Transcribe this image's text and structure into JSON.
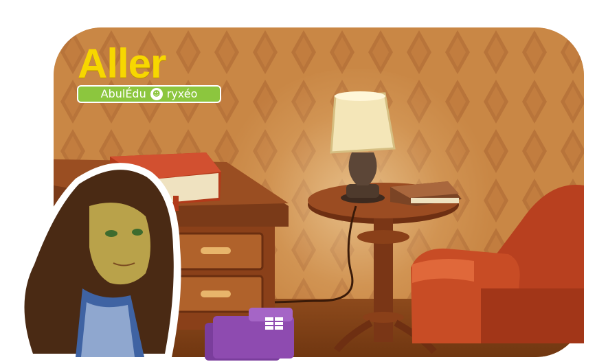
{
  "game": {
    "title": "Aller",
    "brand_left": "AbulÉdu",
    "brand_right": "ryxéo",
    "colors": {
      "title": "#f7d700",
      "brand_bg": "#8cc63e",
      "wall": "#c98745",
      "wall_pattern": "#b8743a",
      "wood": "#8a3f1a",
      "armchair": "#b8401f",
      "folders": "#8e4bb0"
    },
    "scene_icons": [
      "desk-icon",
      "red-book-icon",
      "table-lamp-icon",
      "side-table-icon",
      "brown-book-icon",
      "armchair-icon",
      "purple-folders-icon",
      "girl-character-icon"
    ]
  }
}
